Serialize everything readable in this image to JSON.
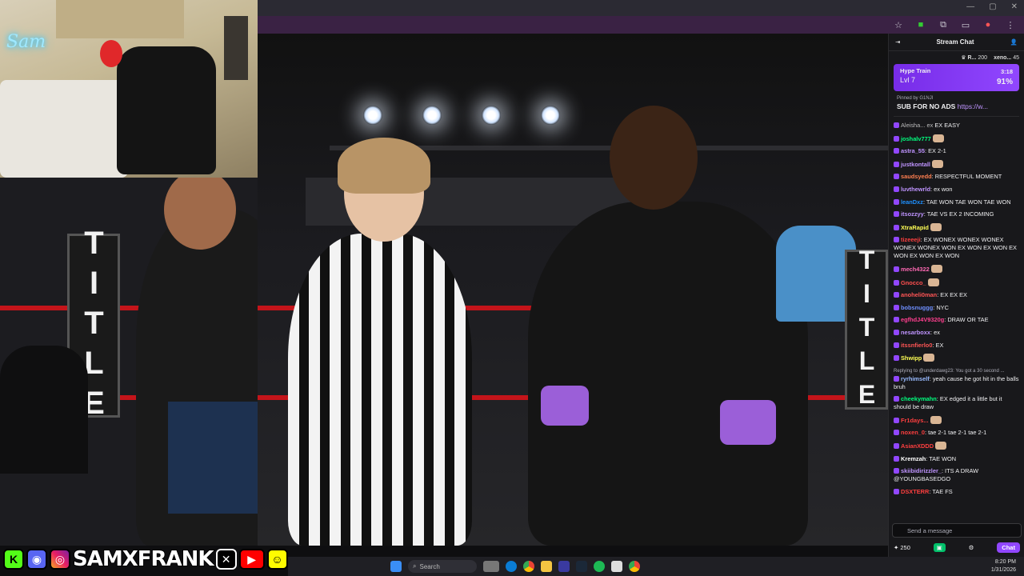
{
  "chat": {
    "title": "Stream Chat",
    "leaderboard": [
      {
        "name": "R...",
        "score": "200"
      },
      {
        "name": "xeno...",
        "score": "45"
      }
    ],
    "hype_train": {
      "label": "Hype Train",
      "level": "Lvl 7",
      "time": "3:18",
      "percent": "91%"
    },
    "pinned": {
      "by": "Pinned by",
      "by_user": "G1NJI",
      "text": "SUB FOR NO ADS",
      "link": "https://w..."
    },
    "messages": [
      {
        "user": "",
        "color": "#ff4f4f",
        "text": "EX EASY",
        "partial": "Aleisha... ex"
      },
      {
        "user": "joshalv777",
        "color": "#00ff7f",
        "text": ""
      },
      {
        "user": "astra_55",
        "color": "#bf94ff",
        "text": "EX 2-1"
      },
      {
        "user": "justkontall",
        "color": "#bf94ff",
        "text": ""
      },
      {
        "user": "saudsyedd",
        "color": "#ff7f50",
        "text": "RESPECTFUL MOMENT"
      },
      {
        "user": "luvthewrld",
        "color": "#bf94ff",
        "text": "ex won"
      },
      {
        "user": "leanDxz",
        "color": "#1e90ff",
        "text": "TAE WON TAE WON TAE WON"
      },
      {
        "user": "itsozzyy",
        "color": "#bf94ff",
        "text": "TAE VS EX 2 INCOMING"
      },
      {
        "user": "XtraRapid",
        "color": "#ffff55",
        "text": ""
      },
      {
        "user": "tizeeeji",
        "color": "#ff3f3f",
        "text": "EX WONEX WONEX WONEX WONEX WONEX WON EX WON EX WON EX WON EX WON EX WON"
      },
      {
        "user": "mech4322",
        "color": "#ff69b4",
        "text": ""
      },
      {
        "user": "Gnocco_",
        "color": "#ff4f4f",
        "text": ""
      },
      {
        "user": "anoheli0man",
        "color": "#ff5555",
        "text": "EX EX EX"
      },
      {
        "user": "bobsnuggg",
        "color": "#6f8fff",
        "text": "NYC"
      },
      {
        "user": "egfhdJ4V9320g",
        "color": "#ff3f8f",
        "text": "DRAW OR TAE"
      },
      {
        "user": "nesarboxx",
        "color": "#bf94ff",
        "text": "ex"
      },
      {
        "user": "itssnfierlo0",
        "color": "#ff5555",
        "text": "EX"
      },
      {
        "user": "Shwipp",
        "color": "#ffff55",
        "text": ""
      },
      {
        "reply": "Replying to @underdawg23: You got a 30 second ...",
        "user": "ryrhimself",
        "color": "#9bf",
        "text": "yeah cause he got hit in the balls bruh"
      },
      {
        "user": "cheekymahn",
        "color": "#00ff7f",
        "text": "EX edged it a little but it should be draw"
      },
      {
        "user": "Fr1days...",
        "color": "#ff3f3f",
        "text": ""
      },
      {
        "user": "noxen_0",
        "color": "#ff3f3f",
        "text": "tae 2-1 tae 2-1 tae 2-1"
      },
      {
        "user": "AsianXDDD",
        "color": "#ff3f3f",
        "text": ""
      },
      {
        "user": "Kremzah",
        "color": "#ffffff",
        "text": "TAE WON"
      },
      {
        "user": "skiibidirizzler_",
        "color": "#bf94ff",
        "text": "ITS A DRAW @YOUNGBASEDGO"
      },
      {
        "user": "DSXTERR",
        "color": "#ff3f3f",
        "text": "TAE FS"
      }
    ],
    "input_placeholder": "Send a message",
    "points": "250",
    "chat_button": "Chat"
  },
  "overlay": {
    "handle": "SAMXFRANK",
    "neon_sign": "Sam"
  },
  "scene": {
    "post_text": "TITLE"
  },
  "taskbar": {
    "search": "Search",
    "time": "8:20 PM",
    "date": "1/31/2026"
  }
}
